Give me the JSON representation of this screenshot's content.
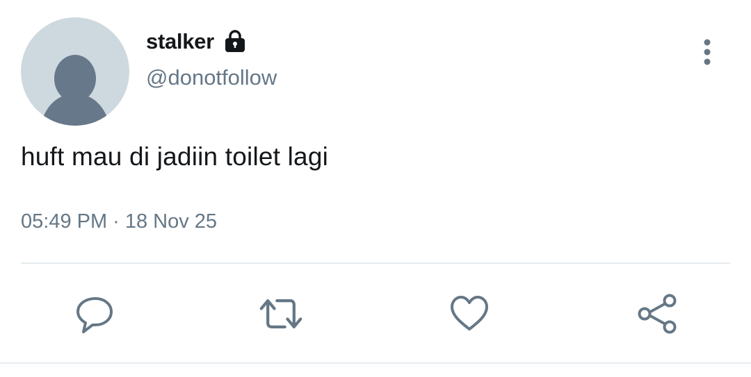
{
  "author": {
    "display_name": "stalker",
    "handle": "@donotfollow",
    "protected": true,
    "avatar": "default-avatar-silhouette"
  },
  "tweet": {
    "text": "huft mau di jadiin toilet lagi",
    "time": "05:49 PM",
    "separator": "·",
    "date": "18 Nov 25"
  },
  "actions": {
    "reply_icon": "reply-icon",
    "retweet_icon": "retweet-icon",
    "like_icon": "heart-icon",
    "share_icon": "share-icon"
  },
  "colors": {
    "primary_text": "#14171a",
    "secondary_text": "#657786",
    "icon_gray": "#657786",
    "divider": "#e6ecf0",
    "avatar_bg": "#ced9df",
    "avatar_figure": "#66788a"
  }
}
